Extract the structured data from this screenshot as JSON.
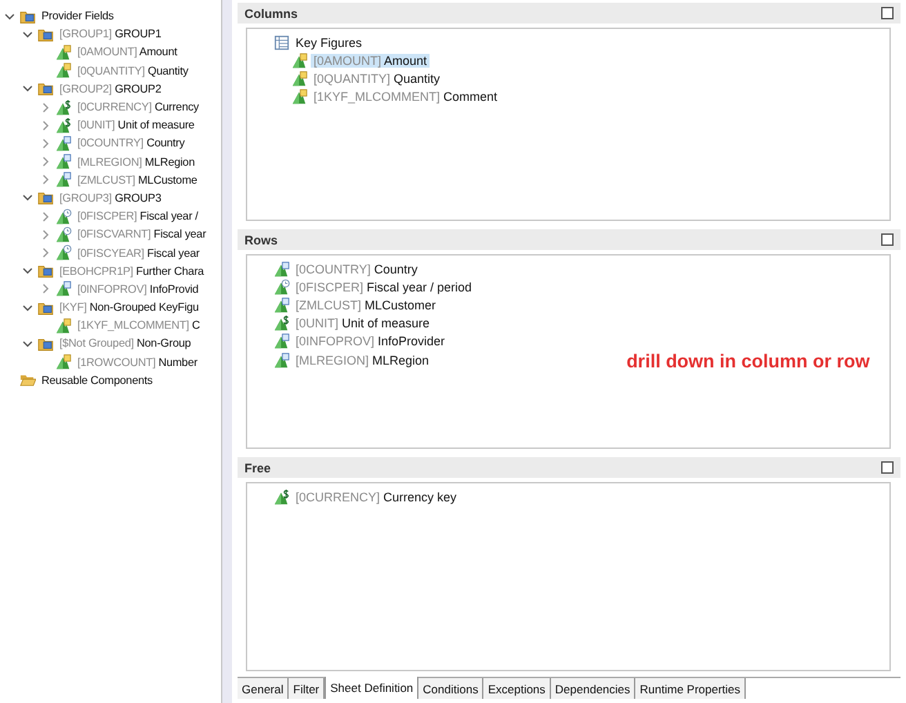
{
  "tree": [
    {
      "kind": "folder",
      "text": "Provider Fields",
      "expanded": true,
      "children": [
        {
          "kind": "folder",
          "key": "[GROUP1]",
          "text": "GROUP1",
          "expanded": true,
          "children": [
            {
              "kind": "keyfigure",
              "key": "[0AMOUNT]",
              "text": "Amount"
            },
            {
              "kind": "keyfigure",
              "key": "[0QUANTITY]",
              "text": "Quantity"
            }
          ]
        },
        {
          "kind": "folder",
          "key": "[GROUP2]",
          "text": "GROUP2",
          "expanded": true,
          "children": [
            {
              "kind": "unit",
              "key": "[0CURRENCY]",
              "text": "Currency",
              "expanded": false
            },
            {
              "kind": "unit",
              "key": "[0UNIT]",
              "text": "Unit of measure",
              "expanded": false
            },
            {
              "kind": "characteristic",
              "key": "[0COUNTRY]",
              "text": "Country",
              "expanded": false
            },
            {
              "kind": "characteristic",
              "key": "[MLREGION]",
              "text": "MLRegion",
              "expanded": false
            },
            {
              "kind": "characteristic",
              "key": "[ZMLCUST]",
              "text": "MLCustome",
              "expanded": false
            }
          ]
        },
        {
          "kind": "folder",
          "key": "[GROUP3]",
          "text": "GROUP3",
          "expanded": true,
          "children": [
            {
              "kind": "time",
              "key": "[0FISCPER]",
              "text": "Fiscal year /",
              "expanded": false
            },
            {
              "kind": "time",
              "key": "[0FISCVARNT]",
              "text": "Fiscal year",
              "expanded": false
            },
            {
              "kind": "time",
              "key": "[0FISCYEAR]",
              "text": "Fiscal year",
              "expanded": false
            }
          ]
        },
        {
          "kind": "folder",
          "key": "[EBOHCPR1P]",
          "text": "Further Chara",
          "expanded": true,
          "children": [
            {
              "kind": "characteristic",
              "key": "[0INFOPROV]",
              "text": "InfoProvid",
              "expanded": false
            }
          ]
        },
        {
          "kind": "folder",
          "key": "[KYF]",
          "text": "Non-Grouped KeyFigu",
          "expanded": true,
          "children": [
            {
              "kind": "keyfigure",
              "key": "[1KYF_MLCOMMENT]",
              "text": "C"
            }
          ]
        },
        {
          "kind": "folder",
          "key": "[$Not Grouped]",
          "text": "Non-Group",
          "expanded": true,
          "children": [
            {
              "kind": "keyfigure",
              "key": "[1ROWCOUNT]",
              "text": "Number"
            }
          ]
        }
      ]
    },
    {
      "kind": "openfolder",
      "text": "Reusable Components"
    }
  ],
  "sections": [
    {
      "title": "Columns",
      "items": [
        {
          "kind": "structure",
          "text": "Key Figures",
          "selected": false,
          "children": [
            {
              "kind": "keyfigure",
              "key": "[0AMOUNT]",
              "text": "Amount",
              "selected": true
            },
            {
              "kind": "keyfigure",
              "key": "[0QUANTITY]",
              "text": "Quantity",
              "selected": false
            },
            {
              "kind": "keyfigure",
              "key": "[1KYF_MLCOMMENT]",
              "text": "Comment",
              "selected": false
            }
          ]
        }
      ]
    },
    {
      "title": "Rows",
      "annotation": "drill down in column or row",
      "items": [
        {
          "kind": "characteristic",
          "key": "[0COUNTRY]",
          "text": "Country",
          "selected": false
        },
        {
          "kind": "time",
          "key": "[0FISCPER]",
          "text": "Fiscal year / period",
          "selected": false
        },
        {
          "kind": "characteristic",
          "key": "[ZMLCUST]",
          "text": "MLCustomer",
          "selected": false
        },
        {
          "kind": "unit",
          "key": "[0UNIT]",
          "text": "Unit of measure",
          "selected": false
        },
        {
          "kind": "characteristic",
          "key": "[0INFOPROV]",
          "text": "InfoProvider",
          "selected": false
        },
        {
          "kind": "characteristic",
          "key": "[MLREGION]",
          "text": "MLRegion",
          "selected": false
        }
      ]
    },
    {
      "title": "Free",
      "items": [
        {
          "kind": "unit",
          "key": "[0CURRENCY]",
          "text": "Currency key",
          "selected": false
        }
      ]
    }
  ],
  "tabs": [
    {
      "label": "General",
      "selected": false
    },
    {
      "label": "Filter",
      "selected": false
    },
    {
      "label": "Sheet Definition",
      "selected": true
    },
    {
      "label": "Conditions",
      "selected": false
    },
    {
      "label": "Exceptions",
      "selected": false
    },
    {
      "label": "Dependencies",
      "selected": false
    },
    {
      "label": "Runtime Properties",
      "selected": false
    }
  ]
}
